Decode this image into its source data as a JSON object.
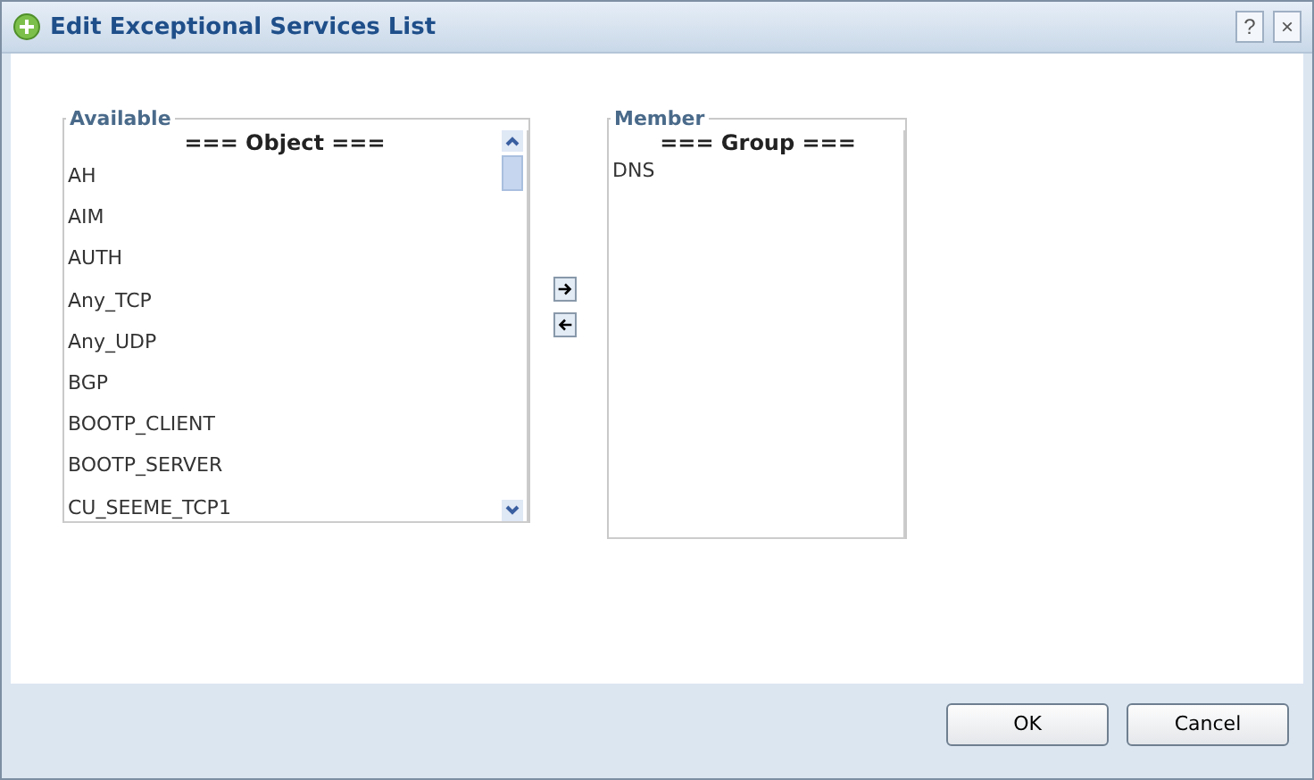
{
  "window": {
    "title": "Edit Exceptional Services List",
    "help": "?",
    "close": "×"
  },
  "available": {
    "legend": "Available",
    "header": "=== Object ===",
    "items": [
      "AH",
      "AIM",
      "AUTH",
      "Any_TCP",
      "Any_UDP",
      "BGP",
      "BOOTP_CLIENT",
      "BOOTP_SERVER",
      "CU_SEEME_TCP1"
    ]
  },
  "member": {
    "legend": "Member",
    "header": "=== Group ===",
    "items": [
      "DNS"
    ]
  },
  "buttons": [
    "OK",
    "Cancel"
  ]
}
